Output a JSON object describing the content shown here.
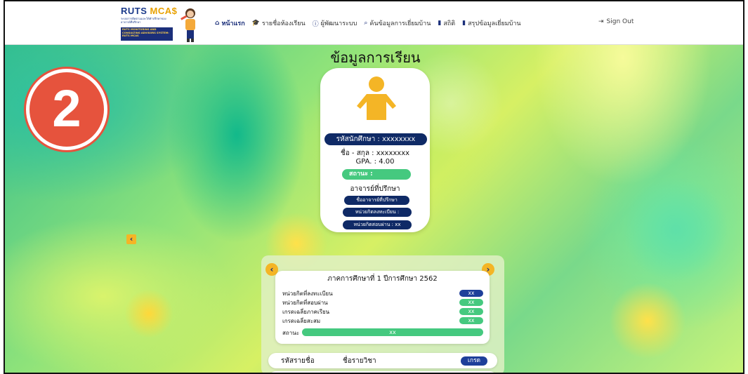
{
  "header": {
    "logo": {
      "title_main": "RUTS",
      "title_accent": "MCA$",
      "subtitle": "ระบบการติดตามและให้คำปรึกษาของอาจารย์ที่ปรึกษา",
      "badge": "RUTS MONITORING AND CONSULTING ADVISORS SYSTEM: RUTS MCAS"
    },
    "nav": [
      {
        "label": "หน้าแรก",
        "icon": "home-icon",
        "glyph": "⌂"
      },
      {
        "label": "รายชื่อห้องเรียน",
        "icon": "graduation-cap-icon",
        "glyph": "🎓"
      },
      {
        "label": "ผู้พัฒนาระบบ",
        "icon": "info-icon",
        "glyph": "ⓘ"
      },
      {
        "label": "ค้นข้อมูลการเยี่ยมบ้าน",
        "icon": "search-icon",
        "glyph": "⌕"
      },
      {
        "label": "สถิติ",
        "icon": "bar-chart-icon",
        "glyph": "▮"
      },
      {
        "label": "สรุปข้อมูลเยี่ยมบ้าน",
        "icon": "bar-chart-icon",
        "glyph": "▮"
      }
    ],
    "signout": {
      "label": "Sign Out",
      "icon": "sign-out-icon",
      "glyph": "⇥"
    }
  },
  "page": {
    "title": "ข้อมูลการเรียน",
    "step_number": "2",
    "nav_prev_glyph": "‹"
  },
  "profile": {
    "avatar_icon": "person-icon",
    "student_id": "รหัสนักศึกษา : xxxxxxxx",
    "name": "ชื่อ - สกุล : xxxxxxxx",
    "gpa": "GPA. : 4.00",
    "status": "สถานะ :",
    "advisor_heading": "อาจารย์ที่ปรึกษา",
    "advisor_name": "ชื่ออาจารย์ที่ปรึกษา",
    "credits_registered": "หน่วยกิตลงทะเบียน :",
    "credits_passed": "หน่วยกิตสอบผ่าน : xx"
  },
  "semester": {
    "prev_glyph": "‹",
    "next_glyph": "›",
    "title": "ภาคการศึกษาที่ 1 ปีการศึกษา 2562",
    "rows": [
      {
        "label": "หน่วยกิตที่ลงทะเบียน",
        "value": "xx",
        "color": "#1e3f9a"
      },
      {
        "label": "หน่วยกิตที่สอบผ่าน",
        "value": "xx",
        "color": "#45c97f"
      },
      {
        "label": "เกรดเฉลี่ยภาคเรียน",
        "value": "xx",
        "color": "#45c97f"
      },
      {
        "label": "เกรดเฉลี่ยสะสม",
        "value": "xx",
        "color": "#45c97f"
      }
    ],
    "status_label": "สถานะ",
    "status_value": "xx",
    "course_header": {
      "code": "รหัสรายชื่อ",
      "name": "ชื่อรายวิชา",
      "grade": "เกรด"
    }
  },
  "colors": {
    "navy": "#0f2a66",
    "green": "#45c97f",
    "accent": "#f4b526",
    "marker": "#e6533d"
  }
}
